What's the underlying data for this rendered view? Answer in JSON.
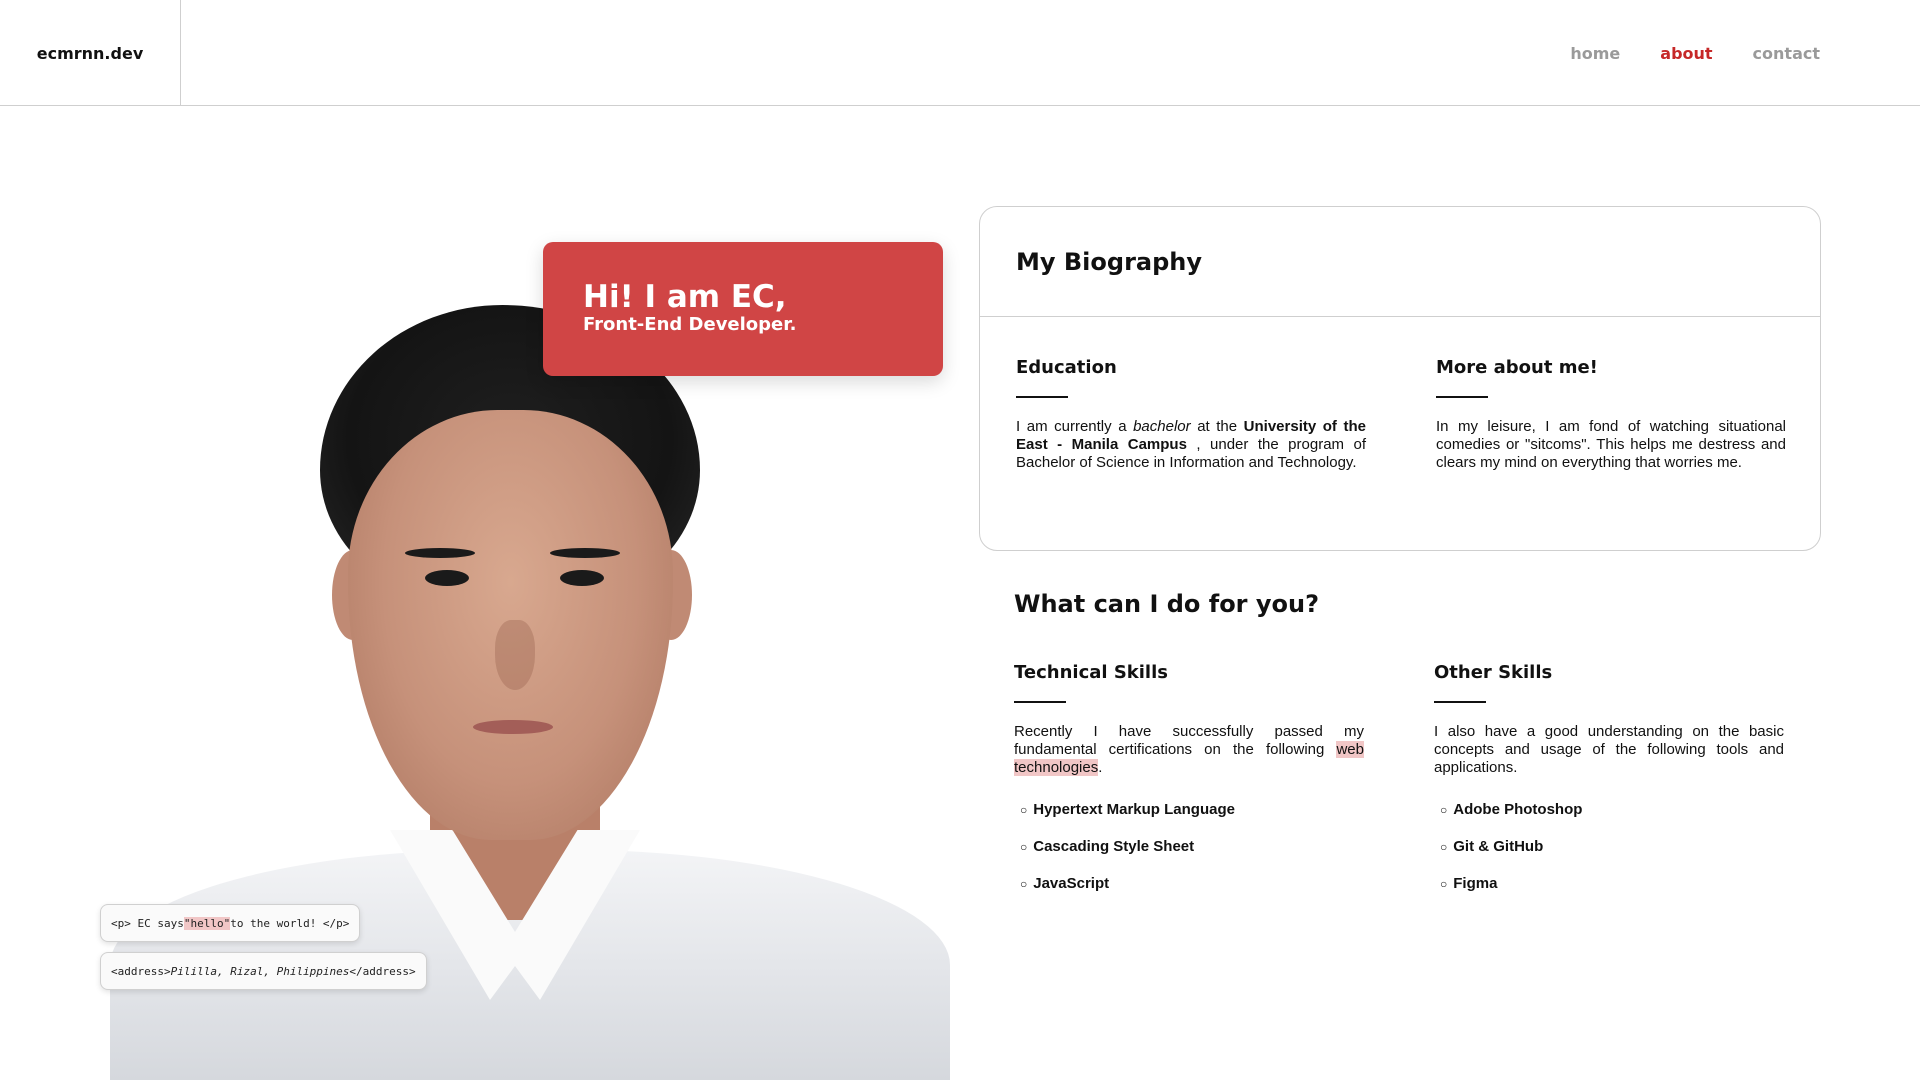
{
  "header": {
    "brand": "ecmrnn.dev",
    "nav": [
      {
        "label": "home"
      },
      {
        "label": "about"
      },
      {
        "label": "contact"
      }
    ],
    "active": "about",
    "accent_color": "#c62828"
  },
  "hero": {
    "greeting": "Hi! I am EC,",
    "role": "Front-End Developer.",
    "card_color": "#d04545",
    "code_tag_1": {
      "open": "<p> EC says ",
      "highlight": "\"hello\"",
      "close": " to the world! </p>"
    },
    "code_tag_2": {
      "open": "<address> ",
      "italic": "Pililla, Rizal, Philippines",
      "close": " </address>"
    }
  },
  "biography": {
    "title": "My Biography",
    "education": {
      "heading": "Education",
      "t1": "I am currently a ",
      "t2": "bachelor",
      "t3": " at the ",
      "t4": "University of the East - Manila Campus",
      "t5": " , under the program of Bachelor of Science in Information and Technology."
    },
    "more": {
      "heading": "More about me!",
      "text": "In my leisure, I am fond of watching situational comedies or \"sitcoms\". This helps me destress and clears my mind on everything that worries me."
    }
  },
  "services": {
    "title": "What can I do for you?",
    "technical": {
      "heading": "Technical Skills",
      "t1": "Recently I have successfully passed my fundamental certifications on the following ",
      "highlight": "web technologies",
      "t2": ".",
      "items": [
        "Hypertext Markup Language",
        "Cascading Style Sheet",
        "JavaScript"
      ]
    },
    "other": {
      "heading": "Other Skills",
      "text": "I also have a good understanding on the basic concepts and usage of the following tools and applications.",
      "items": [
        "Adobe Photoshop",
        "Git & GitHub",
        "Figma"
      ]
    }
  }
}
